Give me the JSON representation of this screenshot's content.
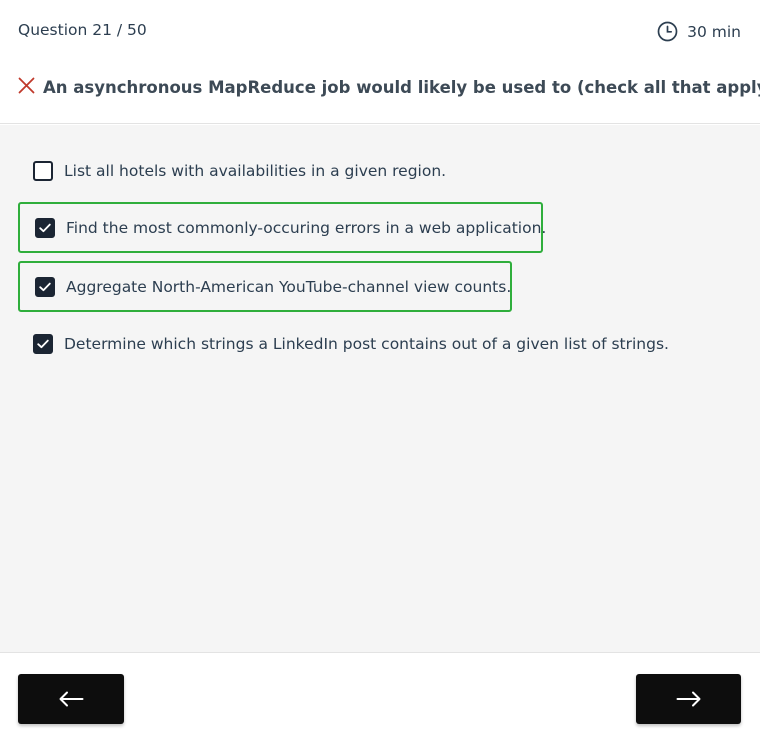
{
  "header": {
    "question_counter": "Question 21 / 50",
    "timer": "30 min",
    "timer_icon": "clock-icon",
    "status_icon": "x-icon",
    "question_text": "An asynchronous MapReduce job would likely be used to (check all that apply):"
  },
  "options": [
    {
      "label": "List all hotels with availabilities in a given region.",
      "checked": false,
      "correct": false
    },
    {
      "label": "Find the most commonly-occuring errors in a web application.",
      "checked": true,
      "correct": true
    },
    {
      "label": "Aggregate North-American YouTube-channel view counts.",
      "checked": true,
      "correct": true
    },
    {
      "label": "Determine which strings a LinkedIn post contains out of a given list of strings.",
      "checked": true,
      "correct": false
    }
  ],
  "footer": {
    "prev_icon": "arrow-left-icon",
    "next_icon": "arrow-right-icon"
  },
  "colors": {
    "correct_border": "#2fae3c",
    "wrong_mark": "#c0392b",
    "checkbox": "#1b2533",
    "button": "#0d0d0d"
  }
}
